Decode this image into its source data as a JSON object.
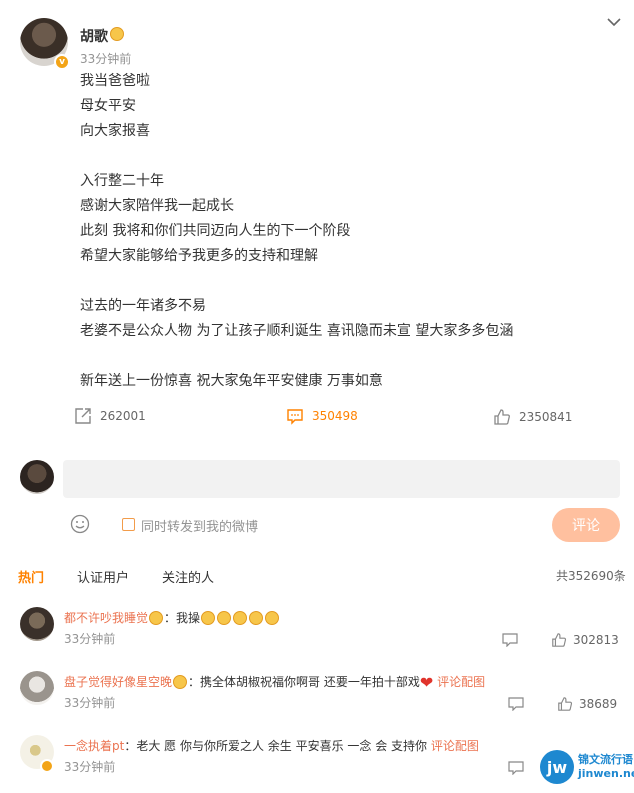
{
  "post": {
    "author": "胡歌",
    "time": "33分钟前",
    "lines": [
      "我当爸爸啦",
      "母女平安",
      "向大家报喜",
      "入行整二十年",
      "感谢大家陪伴我一起成长",
      "此刻 我将和你们共同迈向人生的下一个阶段",
      "希望大家能够给予我更多的支持和理解",
      "过去的一年诸多不易",
      "老婆不是公众人物 为了让孩子顺利诞生 喜讯隐而未宣 望大家多多包涵",
      "新年送上一份惊喜 祝大家兔年平安健康 万事如意"
    ],
    "reposts": "262001",
    "comments": "350498",
    "likes": "2350841"
  },
  "composer": {
    "input_value": "",
    "repost_label": "同时转发到我的微博",
    "submit_label": "评论"
  },
  "tabs": {
    "hot": "热门",
    "verified": "认证用户",
    "following": "关注的人",
    "total": "共352690条"
  },
  "comments": [
    {
      "user": "都不许吵我睡觉",
      "text": "：我操",
      "time": "33分钟前",
      "likes": "302813"
    },
    {
      "user": "盘子觉得好像星空晚",
      "text": "：携全体胡椒祝福你啊哥 还要一年拍十部戏",
      "link": "评论配图",
      "time": "33分钟前",
      "likes": "38689"
    },
    {
      "user": "一念执着pt",
      "text": "：老大 愿 你与你所爱之人 余生 平安喜乐 一念 会 支持你",
      "link": "评论配图",
      "time": "33分钟前"
    }
  ],
  "watermark": {
    "logo": "jw",
    "line1": "锦文流行语",
    "line2": "jinwen.net"
  },
  "colors": {
    "accent": "#ff8200",
    "link": "#eb7350",
    "submit_bg": "#ffc09f"
  }
}
